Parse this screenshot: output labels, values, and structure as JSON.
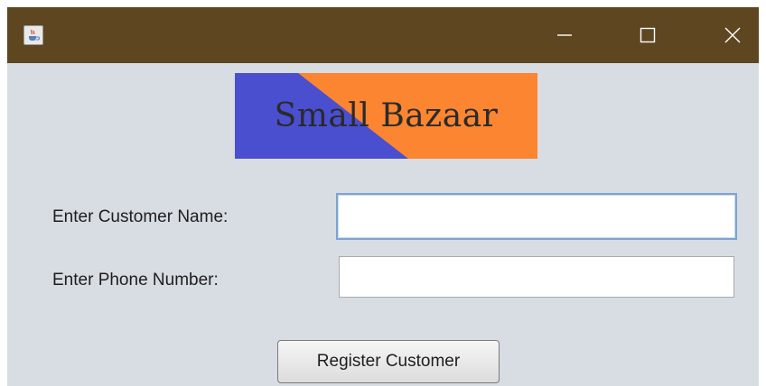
{
  "window": {
    "app_icon": "java-coffee-icon",
    "controls": {
      "minimize_icon": "minimize-icon",
      "maximize_icon": "maximize-icon",
      "close_icon": "close-icon"
    },
    "colors": {
      "titlebar": "#5e4620",
      "background": "#d8dce3"
    }
  },
  "banner": {
    "text": "Small Bazaar",
    "colors": {
      "left": "#4a4fd0",
      "right": "#fb8530"
    }
  },
  "form": {
    "name_label": "Enter Customer Name:",
    "name_value": "",
    "phone_label": "Enter Phone Number:",
    "phone_value": "",
    "register_label": "Register Customer"
  }
}
